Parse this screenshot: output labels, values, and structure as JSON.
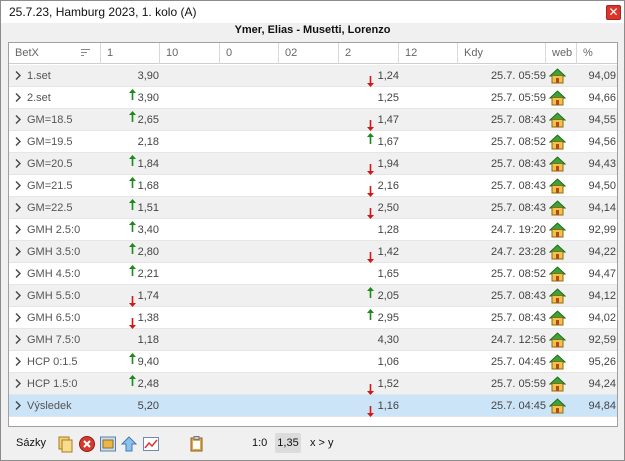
{
  "window": {
    "title": "25.7.23, Hamburg 2023, 1. kolo (A)",
    "close_label": "✕"
  },
  "match": {
    "players": "Ymer, Elias - Musetti, Lorenzo"
  },
  "table": {
    "columns": [
      "BetX",
      "1",
      "10",
      "0",
      "02",
      "2",
      "12",
      "Kdy",
      "web",
      "%"
    ],
    "rows": [
      {
        "name": "1.set",
        "v1": "3,90",
        "v1_arrow": "none",
        "v2": "1,24",
        "v2_arrow": "down",
        "kdy": "25.7. 05:59",
        "pct": "94,09",
        "bg": "alt"
      },
      {
        "name": "2.set",
        "v1": "3,90",
        "v1_arrow": "up",
        "v2": "1,25",
        "v2_arrow": "none",
        "kdy": "25.7. 05:59",
        "pct": "94,66",
        "bg": "white"
      },
      {
        "name": "GM=18.5",
        "v1": "2,65",
        "v1_arrow": "up",
        "v2": "1,47",
        "v2_arrow": "down",
        "kdy": "25.7. 08:43",
        "pct": "94,55",
        "bg": "alt"
      },
      {
        "name": "GM=19.5",
        "v1": "2,18",
        "v1_arrow": "none",
        "v2": "1,67",
        "v2_arrow": "up",
        "kdy": "25.7. 08:52",
        "pct": "94,56",
        "bg": "white"
      },
      {
        "name": "GM=20.5",
        "v1": "1,84",
        "v1_arrow": "up",
        "v2": "1,94",
        "v2_arrow": "down",
        "kdy": "25.7. 08:43",
        "pct": "94,43",
        "bg": "alt"
      },
      {
        "name": "GM=21.5",
        "v1": "1,68",
        "v1_arrow": "up",
        "v2": "2,16",
        "v2_arrow": "down",
        "kdy": "25.7. 08:43",
        "pct": "94,50",
        "bg": "white"
      },
      {
        "name": "GM=22.5",
        "v1": "1,51",
        "v1_arrow": "up",
        "v2": "2,50",
        "v2_arrow": "down",
        "kdy": "25.7. 08:43",
        "pct": "94,14",
        "bg": "alt"
      },
      {
        "name": "GMH 2.5:0",
        "v1": "3,40",
        "v1_arrow": "up",
        "v2": "1,28",
        "v2_arrow": "none",
        "kdy": "24.7. 19:20",
        "pct": "92,99",
        "bg": "white"
      },
      {
        "name": "GMH 3.5:0",
        "v1": "2,80",
        "v1_arrow": "up",
        "v2": "1,42",
        "v2_arrow": "down",
        "kdy": "24.7. 23:28",
        "pct": "94,22",
        "bg": "alt"
      },
      {
        "name": "GMH 4.5:0",
        "v1": "2,21",
        "v1_arrow": "up",
        "v2": "1,65",
        "v2_arrow": "none",
        "kdy": "25.7. 08:52",
        "pct": "94,47",
        "bg": "white"
      },
      {
        "name": "GMH 5.5:0",
        "v1": "1,74",
        "v1_arrow": "down",
        "v2": "2,05",
        "v2_arrow": "up",
        "kdy": "25.7. 08:43",
        "pct": "94,12",
        "bg": "alt"
      },
      {
        "name": "GMH 6.5:0",
        "v1": "1,38",
        "v1_arrow": "down",
        "v2": "2,95",
        "v2_arrow": "up",
        "kdy": "25.7. 08:43",
        "pct": "94,02",
        "bg": "white"
      },
      {
        "name": "GMH 7.5:0",
        "v1": "1,18",
        "v1_arrow": "none",
        "v2": "4,30",
        "v2_arrow": "none",
        "kdy": "24.7. 12:56",
        "pct": "92,59",
        "bg": "alt"
      },
      {
        "name": "HCP 0:1.5",
        "v1": "9,40",
        "v1_arrow": "up",
        "v2": "1,06",
        "v2_arrow": "none",
        "kdy": "25.7. 04:45",
        "pct": "95,26",
        "bg": "white"
      },
      {
        "name": "HCP 1.5:0",
        "v1": "2,48",
        "v1_arrow": "up",
        "v2": "1,52",
        "v2_arrow": "down",
        "kdy": "25.7. 05:59",
        "pct": "94,24",
        "bg": "alt"
      },
      {
        "name": "Výsledek",
        "v1": "5,20",
        "v1_arrow": "none",
        "v2": "1,16",
        "v2_arrow": "down",
        "kdy": "25.7. 04:45",
        "pct": "94,84",
        "bg": "selected"
      }
    ]
  },
  "bottom_bar": {
    "sazky_label": "Sázky",
    "score": "1:0",
    "odd": "1,35",
    "xy": "x > y"
  },
  "colors": {
    "arrow_up": "#1a8a1a",
    "arrow_down": "#d01818",
    "selected_row": "#cce4f7",
    "alt_row": "#f0f0f0"
  }
}
